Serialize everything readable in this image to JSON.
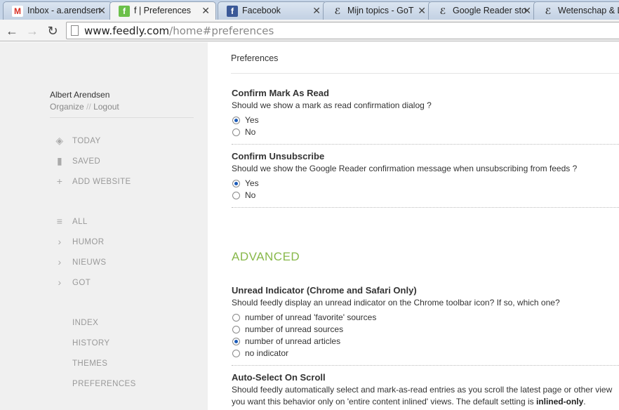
{
  "browser": {
    "tabs": [
      {
        "title": "Inbox - a.arendsen",
        "favicon": "gmail-icon"
      },
      {
        "title": "f | Preferences",
        "favicon": "feedly-icon"
      },
      {
        "title": "Facebook",
        "favicon": "facebook-icon"
      },
      {
        "title": "Mijn topics - GoT",
        "favicon": "forum-icon"
      },
      {
        "title": "Google Reader sto",
        "favicon": "forum-icon"
      },
      {
        "title": "Wetenschap & Le",
        "favicon": "forum-icon"
      }
    ],
    "url_host": "www.feedly.com",
    "url_path": "/home#preferences"
  },
  "sidebar": {
    "user_name": "Albert Arendsen",
    "organize_label": "Organize",
    "separator": "//",
    "logout_label": "Logout",
    "top_items": [
      {
        "label": "TODAY",
        "icon": "today-icon"
      },
      {
        "label": "SAVED",
        "icon": "bookmark-icon"
      },
      {
        "label": "ADD WEBSITE",
        "icon": "plus-icon"
      }
    ],
    "category_items": [
      {
        "label": "ALL",
        "icon": "list-icon"
      },
      {
        "label": "HUMOR",
        "icon": "chevron-right-icon"
      },
      {
        "label": "NIEUWS",
        "icon": "chevron-right-icon"
      },
      {
        "label": "GOT",
        "icon": "chevron-right-icon"
      }
    ],
    "bottom_items": [
      {
        "label": "INDEX"
      },
      {
        "label": "HISTORY"
      },
      {
        "label": "THEMES"
      },
      {
        "label": "PREFERENCES"
      }
    ]
  },
  "main": {
    "page_title": "Preferences",
    "confirm_mark": {
      "title": "Confirm Mark As Read",
      "description": "Should we show a mark as read confirmation dialog ?",
      "options": [
        {
          "label": "Yes",
          "selected": true
        },
        {
          "label": "No",
          "selected": false
        }
      ]
    },
    "confirm_unsub": {
      "title": "Confirm Unsubscribe",
      "description": "Should we show the Google Reader confirmation message when unsubscribing from feeds ?",
      "options": [
        {
          "label": "Yes",
          "selected": true
        },
        {
          "label": "No",
          "selected": false
        }
      ]
    },
    "advanced_heading": "ADVANCED",
    "unread_indicator": {
      "title": "Unread Indicator (Chrome and Safari Only)",
      "description": "Should feedly display an unread indicator on the Chrome toolbar icon? If so, which one?",
      "options": [
        {
          "label": "number of unread 'favorite' sources",
          "selected": false
        },
        {
          "label": "number of unread sources",
          "selected": false
        },
        {
          "label": "number of unread articles",
          "selected": true
        },
        {
          "label": "no indicator",
          "selected": false
        }
      ]
    },
    "auto_select": {
      "title": "Auto-Select On Scroll",
      "description_line1": "Should feedly automatically select and mark-as-read entries as you scroll the latest page or other view",
      "description_line2_prefix": "you want this behavior only on 'entire content inlined' views. The default setting is ",
      "description_line2_bold": "inlined-only",
      "description_line2_suffix": "."
    }
  },
  "colors": {
    "accent_green": "#88b84a",
    "radio_selected": "#1a5ab8",
    "sidebar_bg": "#f0f0f0"
  }
}
